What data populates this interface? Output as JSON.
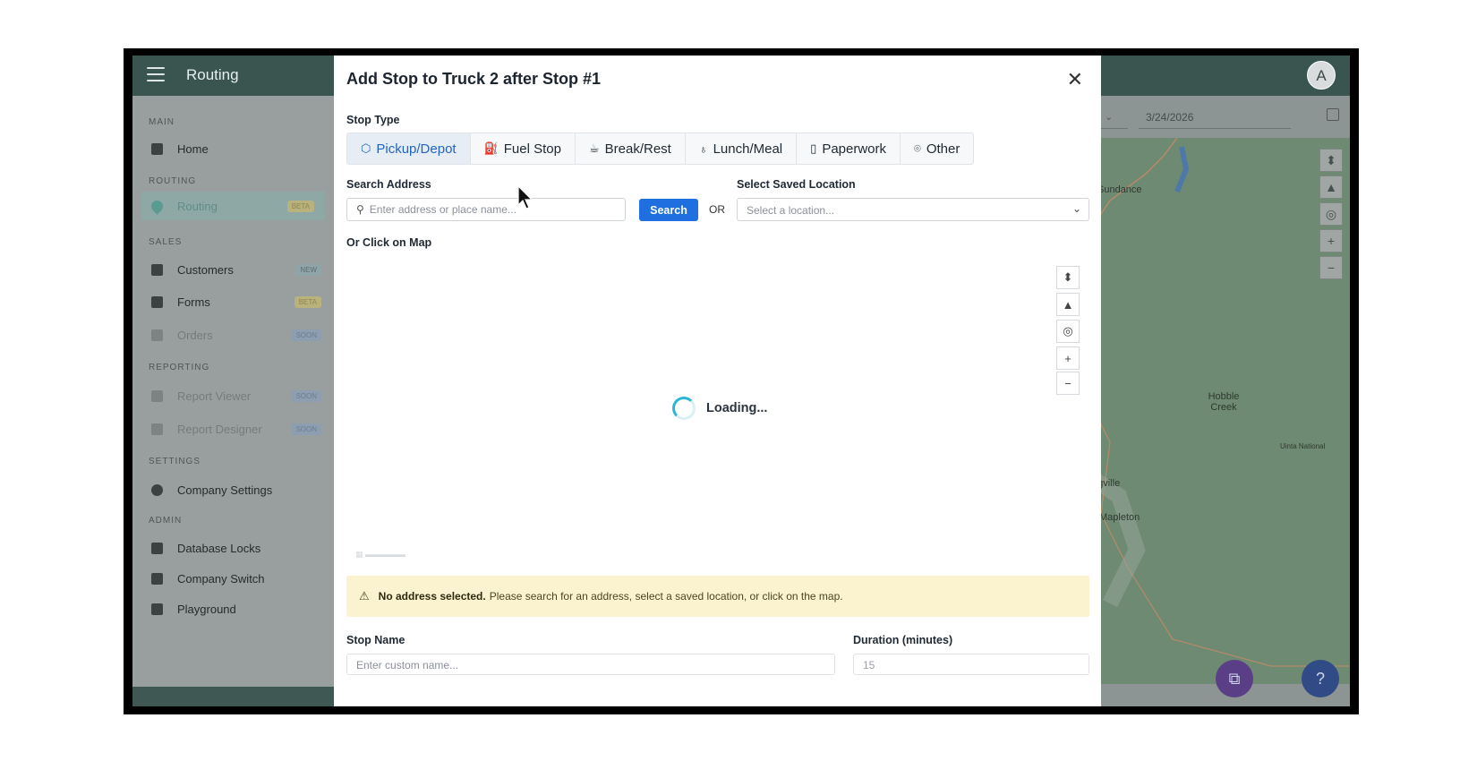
{
  "app": {
    "title": "Routing",
    "avatar_initial": "A"
  },
  "sidebar": {
    "sections": {
      "main": "MAIN",
      "routing": "ROUTING",
      "sales": "SALES",
      "reporting": "REPORTING",
      "settings": "SETTINGS",
      "admin": "ADMIN"
    },
    "items": [
      {
        "label": "Home",
        "icon": "home-icon"
      },
      {
        "label": "Routing",
        "icon": "map-pin-icon",
        "badge": "BETA"
      },
      {
        "label": "Customers",
        "icon": "user-icon",
        "badge": "NEW"
      },
      {
        "label": "Forms",
        "icon": "list-icon",
        "badge": "BETA"
      },
      {
        "label": "Orders",
        "icon": "cart-icon",
        "badge": "SOON"
      },
      {
        "label": "Report Viewer",
        "icon": "report-icon",
        "badge": "SOON"
      },
      {
        "label": "Report Designer",
        "icon": "report-design-icon",
        "badge": "SOON"
      },
      {
        "label": "Company Settings",
        "icon": "gear-icon"
      },
      {
        "label": "Database Locks",
        "icon": "database-icon"
      },
      {
        "label": "Company Switch",
        "icon": "switch-icon"
      },
      {
        "label": "Playground",
        "icon": "playground-icon"
      }
    ]
  },
  "background": {
    "date": "3/24/2026",
    "map_labels": [
      "Sundance",
      "Hobble Creek",
      "Uinta National",
      "ngville",
      "Mapleton"
    ]
  },
  "modal": {
    "title": "Add Stop to Truck 2 after Stop #1",
    "stop_type_label": "Stop Type",
    "stop_types": [
      {
        "label": "Pickup/Depot",
        "icon": "box-icon",
        "selected": true
      },
      {
        "label": "Fuel Stop",
        "icon": "fuel-icon",
        "selected": false
      },
      {
        "label": "Break/Rest",
        "icon": "coffee-icon",
        "selected": false
      },
      {
        "label": "Lunch/Meal",
        "icon": "cup-icon",
        "selected": false
      },
      {
        "label": "Paperwork",
        "icon": "document-icon",
        "selected": false
      },
      {
        "label": "Other",
        "icon": "pin-icon",
        "selected": false
      }
    ],
    "search_address_label": "Search Address",
    "search_placeholder": "Enter address or place name...",
    "search_button": "Search",
    "or_text": "OR",
    "saved_location_label": "Select Saved Location",
    "saved_location_placeholder": "Select a location...",
    "click_map_label": "Or Click on Map",
    "loading_text": "Loading...",
    "alert_bold": "No address selected.",
    "alert_text": "Please search for an address, select a saved location, or click on the map.",
    "stop_name_label": "Stop Name",
    "stop_name_placeholder": "Enter custom name...",
    "duration_label": "Duration (minutes)",
    "duration_value": "15"
  },
  "colors": {
    "primary": "#1f6fe0",
    "topbar": "#3a5550",
    "alert_bg": "#fbf3cf",
    "selected_tab_text": "#2265c4"
  }
}
